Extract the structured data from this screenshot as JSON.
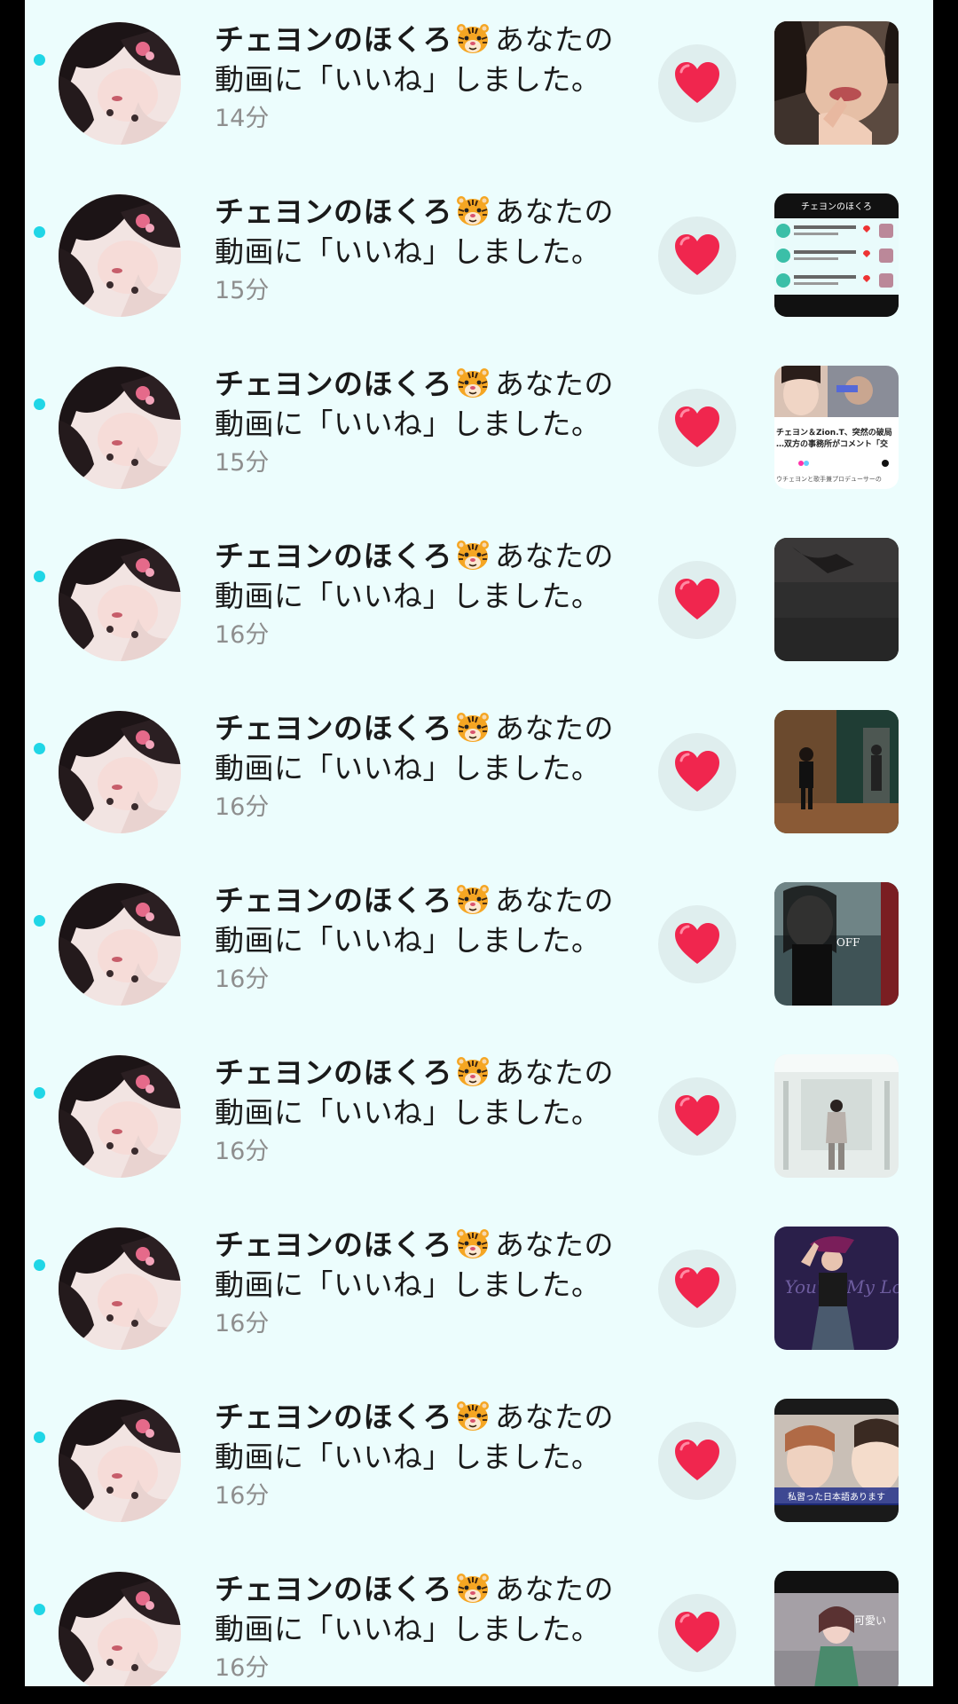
{
  "notification_text": {
    "name": "チェヨンのほくろ",
    "name_emoji_icon": "tiger-face-icon",
    "action_tail": "あなたの",
    "action_line2": "動画に「いいね」しました。"
  },
  "thumb_text": {
    "list_header": "チェヨンのほくろ",
    "news_headline": "チェヨン＆Zion.T、突然の破局",
    "news_sub": "…双方の事務所がコメント「交",
    "news_caption": "ウチェヨンと歌手兼プロデューサーの",
    "dance_word": "OFF",
    "stage_word": "You're My Love?",
    "caption_jp": "私習った日本語あります",
    "caption_kr": "可愛い"
  },
  "notifications": [
    {
      "time": "14分",
      "thumb": "selfie"
    },
    {
      "time": "15分",
      "thumb": "notif-list"
    },
    {
      "time": "15分",
      "thumb": "news"
    },
    {
      "time": "16分",
      "thumb": "dark"
    },
    {
      "time": "16分",
      "thumb": "dance-room"
    },
    {
      "time": "16分",
      "thumb": "dance-bw"
    },
    {
      "time": "16分",
      "thumb": "white-room"
    },
    {
      "time": "16分",
      "thumb": "stage"
    },
    {
      "time": "16分",
      "thumb": "two-faces"
    },
    {
      "time": "16分",
      "thumb": "singer"
    }
  ],
  "colors": {
    "background": "#ecfdfd",
    "unread_dot": "#20d6e6",
    "heart": "#f0264e",
    "time_text": "#8e8e8e"
  }
}
